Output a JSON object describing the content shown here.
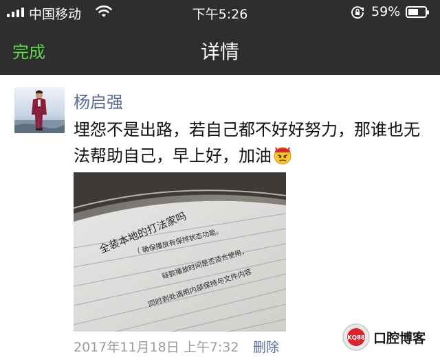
{
  "status_bar": {
    "carrier": "中国移动",
    "time": "下午5:26",
    "battery_percent": "59%",
    "battery_level": 0.59
  },
  "nav": {
    "done_label": "完成",
    "title": "详情"
  },
  "post": {
    "author": "杨启强",
    "text": "埋怨不是出路，若自己都不好好努力，那谁也无法帮助自己，早上好，加油",
    "handwriting_lines": [
      "全装本地的打法家吗",
      "（ 确保播放有保持状态功能。",
      "硅胶播放时间是否适合使用，",
      "同时到处调用内部保持与文件内容"
    ],
    "timestamp": "2017年11月18日 上午7:32",
    "delete_label": "删除"
  },
  "watermark": {
    "badge": "KQ88",
    "text": "口腔博客"
  },
  "colors": {
    "nav_bg": "#2e2e2e",
    "done_green": "#5ed84b",
    "link_blue": "#576b95",
    "meta_gray": "#9b9b9b"
  }
}
